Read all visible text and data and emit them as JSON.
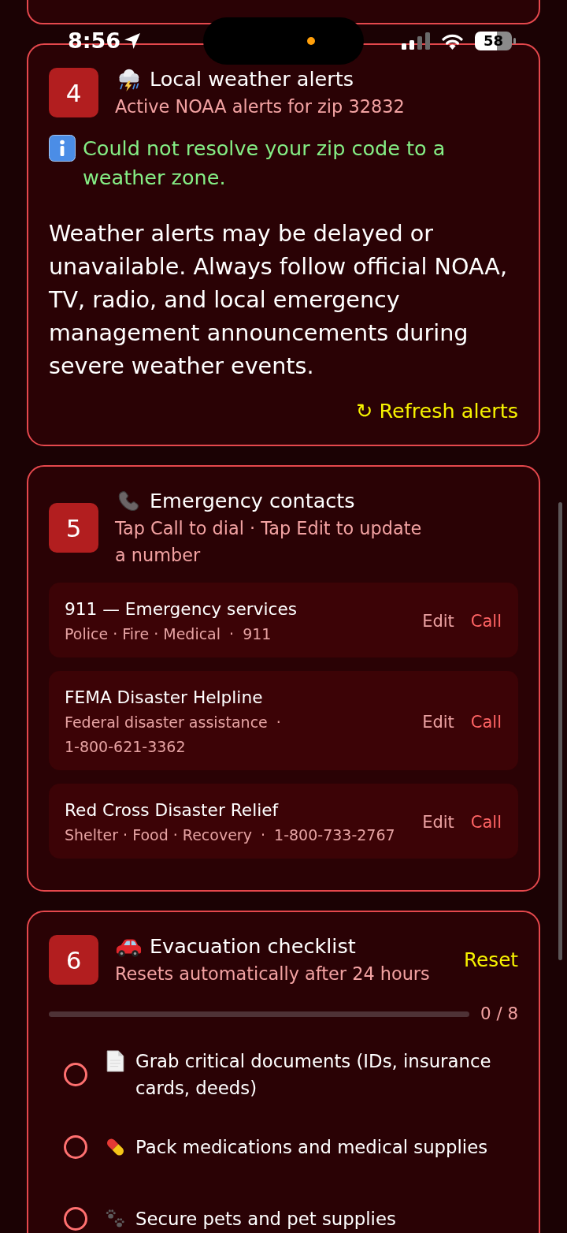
{
  "status_bar": {
    "time": "8:56",
    "battery": "58"
  },
  "sections": [
    {
      "kind": "alerts",
      "number": "4",
      "title": "Local weather alerts",
      "subtitle": "Active NOAA alerts for zip 32832",
      "notice": "Could not resolve your zip code to a weather zone.",
      "disclaimer": "Weather alerts may be delayed or unavailable. Always follow official NOAA, TV, radio, and local emergency management announcements during severe weather events.",
      "action": "↻ Refresh alerts"
    },
    {
      "kind": "contacts",
      "number": "5",
      "title": "Emergency contacts",
      "subtitle": "Tap Call to dial · Tap Edit to update a number",
      "contacts": [
        {
          "name": "911 — Emergency services",
          "description": "Police · Fire · Medical",
          "separator": "·",
          "phone": "911",
          "edit": "Edit",
          "call": "Call"
        },
        {
          "name": "FEMA Disaster Helpline",
          "description": "Federal disaster assistance",
          "separator": "·",
          "phone": "1-800-621-3362",
          "edit": "Edit",
          "call": "Call"
        },
        {
          "name": "Red Cross Disaster Relief",
          "description": "Shelter · Food · Recovery",
          "separator": "·",
          "phone": "1-800-733-2767",
          "edit": "Edit",
          "call": "Call"
        }
      ]
    },
    {
      "kind": "checklist",
      "number": "6",
      "title": "Evacuation checklist",
      "subtitle": "Resets automatically after 24 hours",
      "action": "Reset",
      "progress": {
        "count": "0 / 8"
      },
      "items": [
        {
          "label": "Grab critical documents (IDs, insurance cards, deeds)",
          "checked": false
        },
        {
          "label": "Pack medications and medical supplies",
          "checked": false
        },
        {
          "label": "Secure pets and pet supplies",
          "checked": false
        }
      ]
    }
  ]
}
